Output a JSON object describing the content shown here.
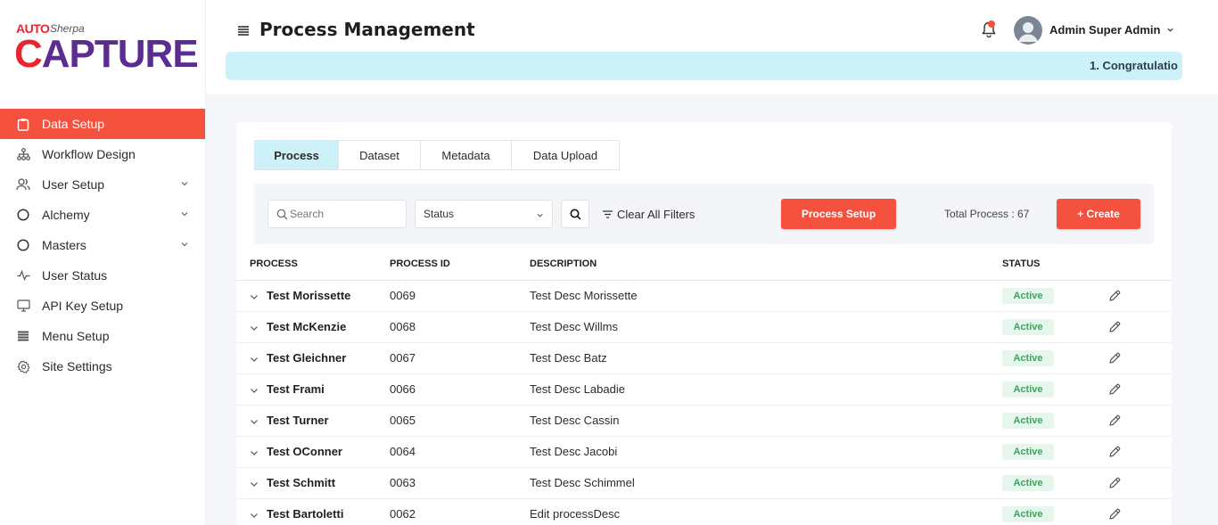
{
  "brand": {
    "auto": "AUTO",
    "sherpa": "Sherpa",
    "capture_c": "C",
    "capture_rest": "APTURE",
    "accent": "#f4523f"
  },
  "sidebar": {
    "items": [
      {
        "label": "Data Setup",
        "icon": "clipboard-icon",
        "active": true
      },
      {
        "label": "Workflow Design",
        "icon": "sitemap-icon"
      },
      {
        "label": "User Setup",
        "icon": "users-icon",
        "has_children": true
      },
      {
        "label": "Alchemy",
        "icon": "circle-icon",
        "has_children": true
      },
      {
        "label": "Masters",
        "icon": "circle-icon",
        "has_children": true
      },
      {
        "label": "User Status",
        "icon": "activity-icon"
      },
      {
        "label": "API Key Setup",
        "icon": "monitor-icon"
      },
      {
        "label": "Menu Setup",
        "icon": "menu-lines-icon"
      },
      {
        "label": "Site Settings",
        "icon": "gear-icon"
      }
    ]
  },
  "header": {
    "title": "Process Management",
    "user_name": "Admin Super Admin",
    "marquee": "1. Congratulatio"
  },
  "tabs": [
    "Process",
    "Dataset",
    "Metadata",
    "Data Upload"
  ],
  "filters": {
    "search_placeholder": "Search",
    "status_label": "Status",
    "clear_label": "Clear All Filters",
    "process_setup_label": "Process Setup",
    "total_label": "Total Process : 67",
    "create_label": "+ Create"
  },
  "table": {
    "headers": [
      "PROCESS",
      "PROCESS ID",
      "DESCRIPTION",
      "STATUS"
    ],
    "rows": [
      {
        "process": "Test Morissette",
        "id": "0069",
        "description": "Test Desc Morissette",
        "status": "Active"
      },
      {
        "process": "Test McKenzie",
        "id": "0068",
        "description": "Test Desc Willms",
        "status": "Active"
      },
      {
        "process": "Test Gleichner",
        "id": "0067",
        "description": "Test Desc Batz",
        "status": "Active"
      },
      {
        "process": "Test Frami",
        "id": "0066",
        "description": "Test Desc Labadie",
        "status": "Active"
      },
      {
        "process": "Test Turner",
        "id": "0065",
        "description": "Test Desc Cassin",
        "status": "Active"
      },
      {
        "process": "Test OConner",
        "id": "0064",
        "description": "Test Desc Jacobi",
        "status": "Active"
      },
      {
        "process": "Test Schmitt",
        "id": "0063",
        "description": "Test Desc Schimmel",
        "status": "Active"
      },
      {
        "process": "Test Bartoletti",
        "id": "0062",
        "description": "Edit processDesc",
        "status": "Active"
      }
    ]
  }
}
